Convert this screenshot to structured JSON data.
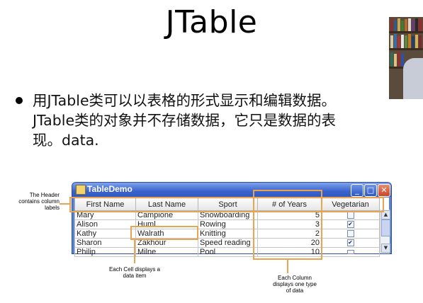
{
  "slide": {
    "title": "JTable",
    "bullet_line1": "用JTable类可以以表格的形式显示和编辑数据。",
    "bullet_line2": "JTable类的对象并不存储数据，它只是数据的表",
    "bullet_line3": "现。data."
  },
  "window": {
    "title": "TableDemo",
    "buttons": {
      "minimize": "_",
      "maximize": "□",
      "close": "✕"
    }
  },
  "table": {
    "columns": [
      "First Name",
      "Last Name",
      "Sport",
      "# of Years",
      "Vegetarian"
    ],
    "rows": [
      {
        "first": "Mary",
        "last": "Campione",
        "sport": "Snowboarding",
        "years": "5",
        "veg": false
      },
      {
        "first": "Alison",
        "last": "Huml",
        "sport": "Rowing",
        "years": "3",
        "veg": true
      },
      {
        "first": "Kathy",
        "last": "Walrath",
        "sport": "Knitting",
        "years": "2",
        "veg": false
      },
      {
        "first": "Sharon",
        "last": "Zakhour",
        "sport": "Speed reading",
        "years": "20",
        "veg": true
      },
      {
        "first": "Philip",
        "last": "Milne",
        "sport": "Pool",
        "years": "10",
        "veg": false
      }
    ],
    "check_glyph": "✔"
  },
  "annotations": {
    "header_note": "The Header contains column labels",
    "cell_note": "Each Cell displays a data item",
    "column_note": "Each Column displays one type of data"
  },
  "colors": {
    "highlight": "#e8a451",
    "titlebar": "#3b63cc"
  }
}
